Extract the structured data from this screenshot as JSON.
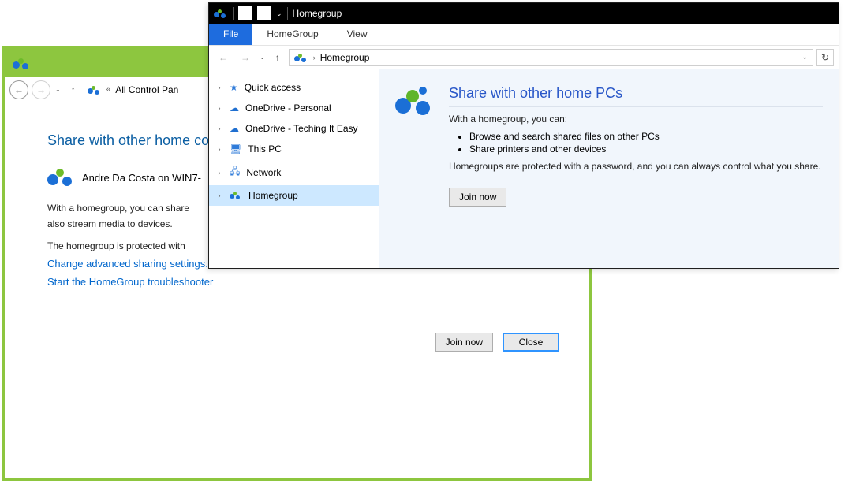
{
  "backWindow": {
    "breadcrumb": "All Control Pan",
    "heading": "Share with other home co",
    "creator": "Andre Da Costa on WIN7-",
    "line1": "With a homegroup, you can share",
    "line2": "also stream media to devices.",
    "line3": "The homegroup is protected with",
    "link1": "Change advanced sharing settings...",
    "link2": "Start the HomeGroup troubleshooter",
    "joinBtn": "Join now",
    "closeBtn": "Close"
  },
  "frontWindow": {
    "title": "Homegroup",
    "tabs": {
      "file": "File",
      "homegroup": "HomeGroup",
      "view": "View"
    },
    "address": "Homegroup",
    "sidebar": [
      {
        "label": "Quick access",
        "icon": "star"
      },
      {
        "label": "OneDrive - Personal",
        "icon": "cloud"
      },
      {
        "label": "OneDrive - Teching It Easy",
        "icon": "cloud"
      },
      {
        "label": "This PC",
        "icon": "monitor"
      },
      {
        "label": "Network",
        "icon": "network"
      },
      {
        "label": "Homegroup",
        "icon": "homegroup",
        "selected": true
      }
    ],
    "main": {
      "heading": "Share with other home PCs",
      "intro": "With a homegroup, you can:",
      "bullets": [
        "Browse and search shared files on other PCs",
        "Share printers and other devices"
      ],
      "protect": "Homegroups are protected with a password, and you can always control what you share.",
      "joinBtn": "Join now"
    }
  }
}
